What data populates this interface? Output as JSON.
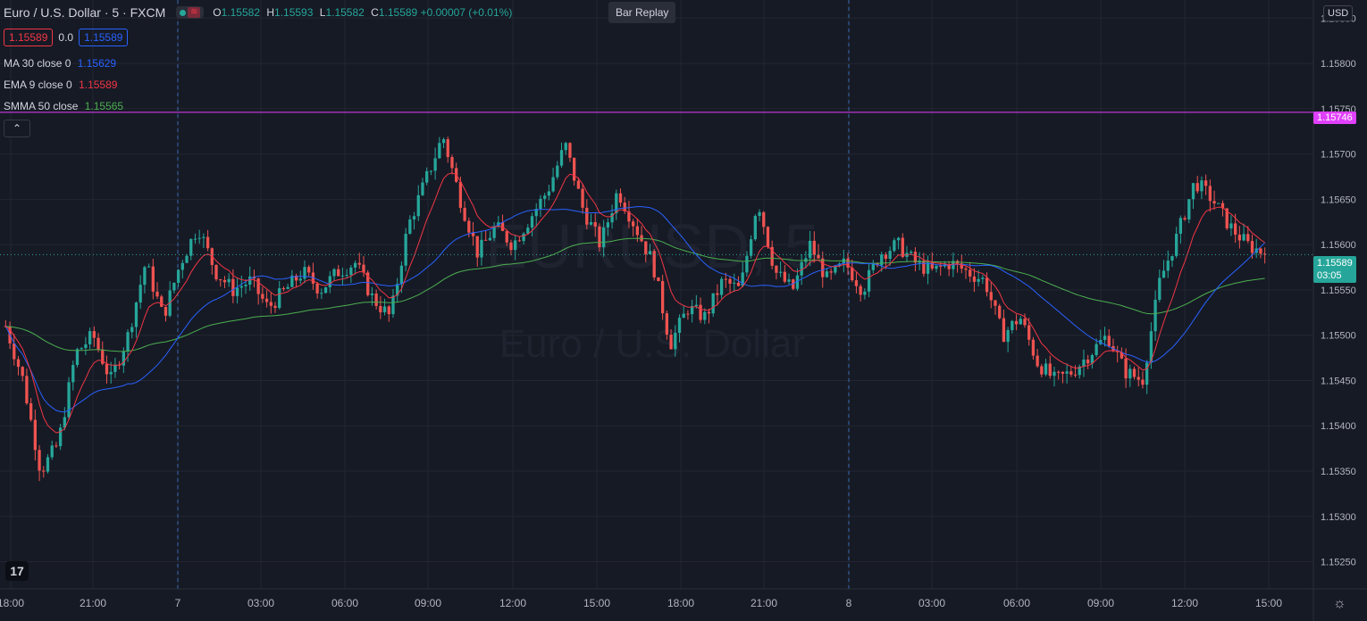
{
  "header": {
    "symbol_title": "Euro / U.S. Dollar · 5 · FXCM",
    "ohlc": {
      "o_label": "O",
      "o": "1.15582",
      "h_label": "H",
      "h": "1.15593",
      "l_label": "L",
      "l": "1.15582",
      "c_label": "C",
      "c": "1.15589",
      "change": "+0.00007 (+0.01%)"
    },
    "bid": "1.15589",
    "spread": "0.0",
    "ask": "1.15589",
    "collapse_icon": "chevron-up-icon"
  },
  "indicators": [
    {
      "name": "MA 30 close 0",
      "value": "1.15629",
      "color": "#2962ff"
    },
    {
      "name": "EMA 9 close 0",
      "value": "1.15589",
      "color": "#f23645"
    },
    {
      "name": "SMMA 50 close",
      "value": "1.15565",
      "color": "#4caf50"
    }
  ],
  "toolbar": {
    "bar_replay_label": "Bar Replay"
  },
  "currency_label": "USD",
  "watermark": {
    "line1": "EURUSD, 5",
    "line2": "Euro / U.S. Dollar"
  },
  "price_tags": {
    "horizontal_line": "1.15746",
    "last_price": "1.15589",
    "countdown": "03:05"
  },
  "colors": {
    "up": "#26a69a",
    "down": "#ef5350",
    "hline": "#e040fb",
    "background": "#161a25"
  },
  "chart_data": {
    "type": "candlestick",
    "y_axis_ticks": [
      "1.15850",
      "1.15800",
      "1.15750",
      "1.15700",
      "1.15650",
      "1.15600",
      "1.15550",
      "1.15500",
      "1.15450",
      "1.15400",
      "1.15350",
      "1.15300",
      "1.15250"
    ],
    "x_axis_ticks": [
      "18:00",
      "21:00",
      "7",
      "03:00",
      "06:00",
      "09:00",
      "12:00",
      "15:00",
      "18:00",
      "21:00",
      "8",
      "03:00",
      "06:00",
      "09:00",
      "12:00",
      "15:00"
    ],
    "ylim": [
      1.1522,
      1.1587
    ],
    "horizontal_line": 1.15746,
    "close_path": [
      [
        0,
        1.1551
      ],
      [
        0.01,
        1.1545
      ],
      [
        0.02,
        1.1535
      ],
      [
        0.03,
        1.1538
      ],
      [
        0.04,
        1.1548
      ],
      [
        0.05,
        1.155
      ],
      [
        0.06,
        1.1545
      ],
      [
        0.07,
        1.155
      ],
      [
        0.08,
        1.1558
      ],
      [
        0.09,
        1.1552
      ],
      [
        0.1,
        1.1558
      ],
      [
        0.11,
        1.1562
      ],
      [
        0.12,
        1.1557
      ],
      [
        0.13,
        1.1555
      ],
      [
        0.14,
        1.1556
      ],
      [
        0.15,
        1.1553
      ],
      [
        0.16,
        1.1555
      ],
      [
        0.17,
        1.1557
      ],
      [
        0.18,
        1.1555
      ],
      [
        0.19,
        1.1557
      ],
      [
        0.2,
        1.1558
      ],
      [
        0.21,
        1.1554
      ],
      [
        0.22,
        1.1552
      ],
      [
        0.23,
        1.1562
      ],
      [
        0.24,
        1.1567
      ],
      [
        0.25,
        1.1572
      ],
      [
        0.26,
        1.1565
      ],
      [
        0.27,
        1.1559
      ],
      [
        0.28,
        1.1562
      ],
      [
        0.29,
        1.156
      ],
      [
        0.3,
        1.1563
      ],
      [
        0.31,
        1.1566
      ],
      [
        0.32,
        1.1571
      ],
      [
        0.33,
        1.1564
      ],
      [
        0.34,
        1.156
      ],
      [
        0.35,
        1.1566
      ],
      [
        0.36,
        1.1562
      ],
      [
        0.37,
        1.1558
      ],
      [
        0.38,
        1.1549
      ],
      [
        0.39,
        1.1553
      ],
      [
        0.4,
        1.1552
      ],
      [
        0.41,
        1.1556
      ],
      [
        0.42,
        1.1555
      ],
      [
        0.43,
        1.1565
      ],
      [
        0.44,
        1.1557
      ],
      [
        0.45,
        1.1555
      ],
      [
        0.46,
        1.156
      ],
      [
        0.47,
        1.1556
      ],
      [
        0.48,
        1.1558
      ],
      [
        0.49,
        1.1555
      ],
      [
        0.5,
        1.1559
      ],
      [
        0.51,
        1.156
      ],
      [
        0.52,
        1.1558
      ],
      [
        0.53,
        1.1557
      ],
      [
        0.54,
        1.1558
      ],
      [
        0.55,
        1.1557
      ],
      [
        0.56,
        1.1556
      ],
      [
        0.57,
        1.155
      ],
      [
        0.58,
        1.1552
      ],
      [
        0.59,
        1.1547
      ],
      [
        0.6,
        1.1545
      ],
      [
        0.61,
        1.1546
      ],
      [
        0.62,
        1.1548
      ],
      [
        0.63,
        1.155
      ],
      [
        0.64,
        1.1546
      ],
      [
        0.65,
        1.1545
      ],
      [
        0.66,
        1.1556
      ],
      [
        0.67,
        1.1561
      ],
      [
        0.68,
        1.1567
      ],
      [
        0.69,
        1.1565
      ],
      [
        0.7,
        1.1562
      ],
      [
        0.71,
        1.156
      ],
      [
        0.72,
        1.1559
      ]
    ],
    "ma30_path": "smooth",
    "last_close": 1.15589
  }
}
